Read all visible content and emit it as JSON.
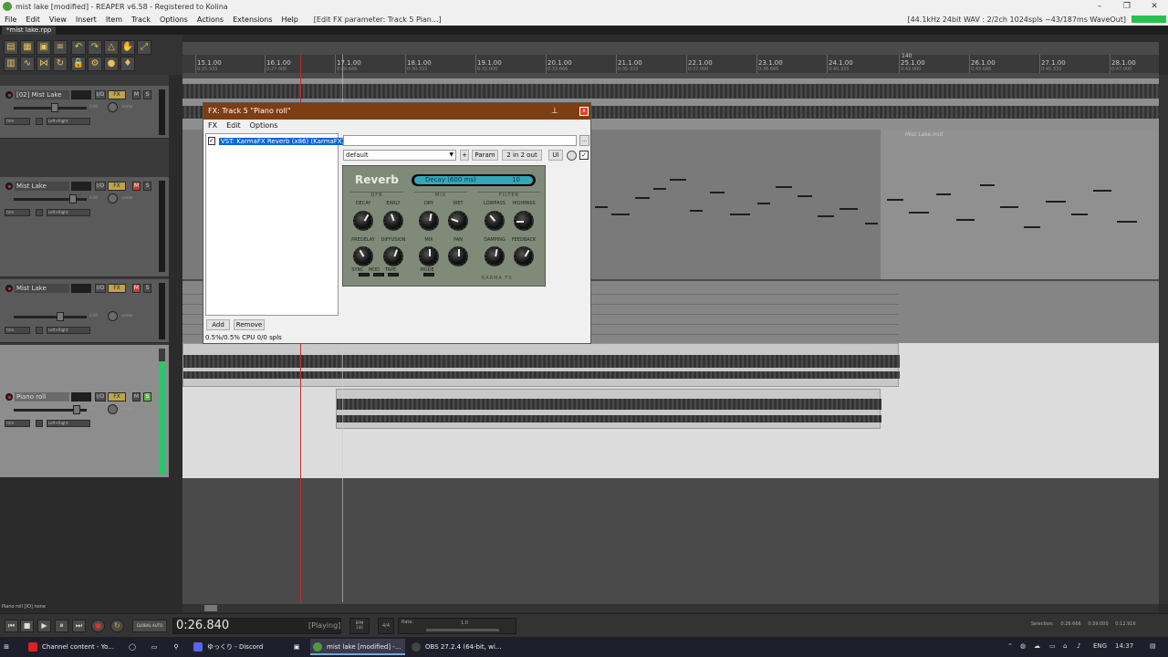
{
  "window": {
    "title": "mist lake [modified] - REAPER v6.58 - Registered to Kolina",
    "minimize": "–",
    "restore": "❐",
    "close": "✕"
  },
  "menu": {
    "items": [
      "File",
      "Edit",
      "View",
      "Insert",
      "Item",
      "Track",
      "Options",
      "Actions",
      "Extensions",
      "Help"
    ],
    "fx_param": "[Edit FX parameter: Track 5 Pian...]",
    "status": "[44.1kHz 24bit WAV : 2/2ch 1024spls ~43/187ms WaveOut]"
  },
  "project_tab": "*mist lake.rpp",
  "ruler": {
    "marks": [
      {
        "label": "15.1.00",
        "sub": "0:25.333"
      },
      {
        "label": "16.1.00",
        "sub": "0:27.000"
      },
      {
        "label": "17.1.00",
        "sub": "0:28.666"
      },
      {
        "label": "18.1.00",
        "sub": "0:30.333"
      },
      {
        "label": "19.1.00",
        "sub": "0:32.000"
      },
      {
        "label": "20.1.00",
        "sub": "0:33.666"
      },
      {
        "label": "21.1.00",
        "sub": "0:35.333"
      },
      {
        "label": "22.1.00",
        "sub": "0:37.000"
      },
      {
        "label": "23.1.00",
        "sub": "0:38.666"
      },
      {
        "label": "24.1.00",
        "sub": "0:40.333"
      },
      {
        "label": "25.1.00",
        "sub": "0:42.000"
      },
      {
        "label": "26.1.00",
        "sub": "0:43.666"
      },
      {
        "label": "27.1.00",
        "sub": "0:45.333"
      },
      {
        "label": "28.1.00",
        "sub": "0:47.000"
      }
    ],
    "tempo_marker": "140"
  },
  "tracks": [
    {
      "name": "[02] Mist Lake",
      "io": "I/O",
      "fx": "FX",
      "mute": "M",
      "solo": "S",
      "vol": "0.00",
      "pan": "center",
      "mode": "trim",
      "routing": "Left+Right"
    },
    {
      "name": "Mist Lake",
      "io": "I/O",
      "fx": "FX",
      "mute": "M",
      "solo": "S",
      "vol": "0.00",
      "pan": "center",
      "mode": "trim",
      "routing": "Left+Right"
    },
    {
      "name": "Mist Lake",
      "io": "I/O",
      "fx": "FX",
      "mute": "M",
      "solo": "S",
      "vol": "0.00",
      "pan": "center",
      "mode": "trim",
      "routing": "Left+Right"
    },
    {
      "name": "Piano roll",
      "io": "I/O",
      "fx": "FX",
      "mute": "M",
      "solo": "S",
      "vol": "0.00",
      "pan": "center",
      "mode": "trim",
      "routing": "Left+Right"
    }
  ],
  "item_labels": {
    "mist_lake_midi": "Mist Lake.mid",
    "pitch_a": "[Pitch -4.00] yanpi...",
    "pitch_b": "[Pitch -9.00",
    "pitch_c": "[Pitch -4.00]",
    "pitch_d": "[Pitch...",
    "pitch_e": "[Pi..."
  },
  "fx_window": {
    "title": "FX: Track 5 \"Piano roll\"",
    "pin": "📌",
    "close": "x",
    "menu": [
      "FX",
      "Edit",
      "Options"
    ],
    "chain": [
      {
        "name": "VST: KarmaFX Reverb (x86) (KarmaFX)",
        "checked": "✓"
      }
    ],
    "add": "Add",
    "remove": "Remove",
    "cpu": "0.5%/0.5% CPU 0/0 spls",
    "more": "...",
    "preset": "default",
    "plus": "+",
    "param": "Param",
    "io": "2 in 2 out",
    "ui": "UI",
    "bypass": "✓"
  },
  "plugin": {
    "title": "Reverb",
    "display_param": "Decay (600 ms)",
    "display_value": "10",
    "groups": [
      "DFB",
      "MIX",
      "FILTER"
    ],
    "knobs_top": [
      "DECAY",
      "EARLY",
      "DRY",
      "WET",
      "LOWPASS",
      "HIGHPASS"
    ],
    "knobs_bottom": [
      "PREDELAY",
      "DIFFUSION",
      "MIX",
      "PAN",
      "DAMPING",
      "FEEDBACK"
    ],
    "switches": [
      "SYNC",
      "MOD",
      "TAPE",
      "MODE"
    ],
    "brand": "KARMA FX"
  },
  "status_left": "Piano roll [IO] none",
  "transport": {
    "time": "0:26.840",
    "state": "[Playing]",
    "bpm_label": "BPM",
    "bpm": "140",
    "sig": "4/4",
    "rate_label": "Rate:",
    "rate": "1.0",
    "global_auto": "GLOBAL AUTO",
    "selection_label": "Selection:",
    "sel_start": "0:26.666",
    "sel_end": "0:39.000",
    "sel_len": "0:12.916"
  },
  "taskbar": {
    "items": [
      {
        "label": "Channel content - Yo...",
        "color": "#d22"
      },
      {
        "label": "ゆっくり - Discord",
        "color": "#5865f2"
      },
      {
        "label": "mist lake [modified] -...",
        "color": "#4c9c3c"
      },
      {
        "label": "OBS 27.2.4 (64-bit, wi...",
        "color": "#333"
      }
    ],
    "lang": "ENG",
    "time": "14:37"
  },
  "colors": {
    "fx_title_bg": "#7d3e12",
    "plugin_bg": "#7f8a78",
    "lcd": "#35a6b8",
    "play_cursor": "#b03232"
  }
}
